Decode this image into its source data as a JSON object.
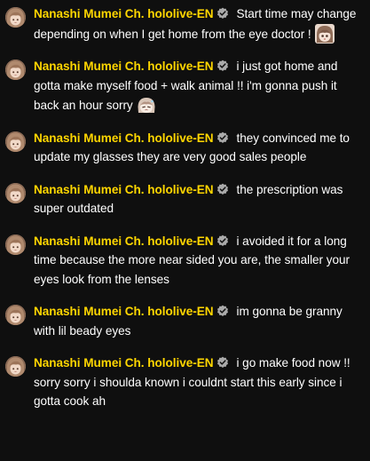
{
  "chat": {
    "messages": [
      {
        "author": "Nanashi Mumei Ch. hololive-EN",
        "text": "Start time may change depending on when I get home from the eye doctor !",
        "emote": "mumei-face-emote"
      },
      {
        "author": "Nanashi Mumei Ch. hololive-EN",
        "text": "i just got home and gotta make myself food + walk animal !! i'm gonna push it back an hour sorry",
        "emote": "mumei-sorry-emote"
      },
      {
        "author": "Nanashi Mumei Ch. hololive-EN",
        "text": "they convinced me to update my glasses they are very good sales people",
        "emote": null
      },
      {
        "author": "Nanashi Mumei Ch. hololive-EN",
        "text": "the prescription was super outdated",
        "emote": null
      },
      {
        "author": "Nanashi Mumei Ch. hololive-EN",
        "text": "i avoided it for a long time because the more near sided you are, the smaller your eyes look from the lenses",
        "emote": null
      },
      {
        "author": "Nanashi Mumei Ch. hololive-EN",
        "text": "im gonna be granny with lil beady eyes",
        "emote": null
      },
      {
        "author": "Nanashi Mumei Ch. hololive-EN",
        "text": "i go make food now !! sorry sorry i shoulda known i couldnt start this early since i gotta cook ah",
        "emote": null
      }
    ]
  },
  "colors": {
    "background": "#0f0f0f",
    "author": "#ffd600",
    "text": "#ffffff",
    "badge": "#aaaaaa"
  },
  "icons": {
    "avatar": "channel-avatar",
    "badge": "verified-check-icon"
  }
}
